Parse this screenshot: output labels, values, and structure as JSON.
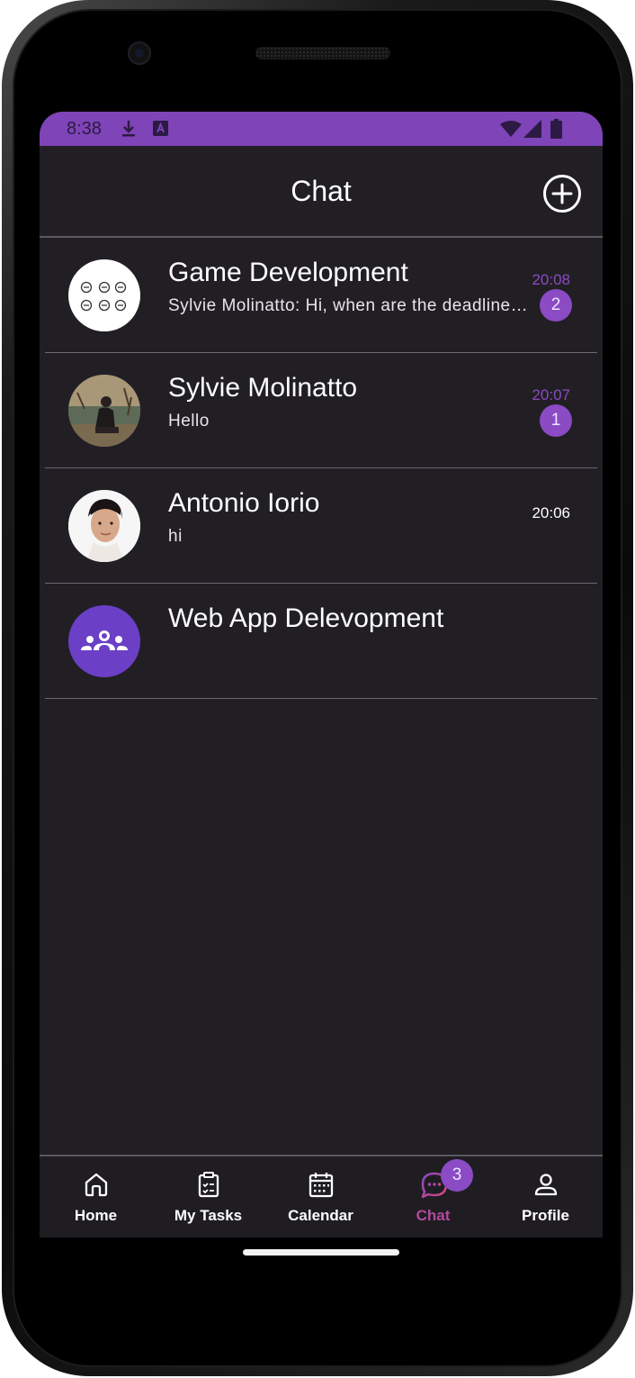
{
  "status_bar": {
    "time": "8:38"
  },
  "header": {
    "title": "Chat"
  },
  "chats": [
    {
      "name": "Game Development",
      "message": "Sylvie Molinatto: Hi, when are the deadlines?",
      "time": "20:08",
      "unread": "2",
      "time_color": "#8a4bc4"
    },
    {
      "name": "Sylvie Molinatto",
      "message": "Hello",
      "time": "20:07",
      "unread": "1",
      "time_color": "#8a4bc4"
    },
    {
      "name": "Antonio Iorio",
      "message": "hi",
      "time": "20:06",
      "time_color": "#ffffff"
    },
    {
      "name": "Web App Delevopment",
      "message": ""
    }
  ],
  "nav": {
    "items": [
      {
        "label": "Home",
        "icon": "home-icon"
      },
      {
        "label": "My Tasks",
        "icon": "clipboard-check-icon"
      },
      {
        "label": "Calendar",
        "icon": "calendar-icon"
      },
      {
        "label": "Chat",
        "icon": "chat-bubble-icon",
        "active": true
      },
      {
        "label": "Profile",
        "icon": "person-icon"
      }
    ],
    "chat_badge": "3"
  },
  "colors": {
    "accent": "#8a4bc4",
    "status_bar": "#7e44b8",
    "background": "#211f24",
    "active_nav": "#c04a9a"
  }
}
